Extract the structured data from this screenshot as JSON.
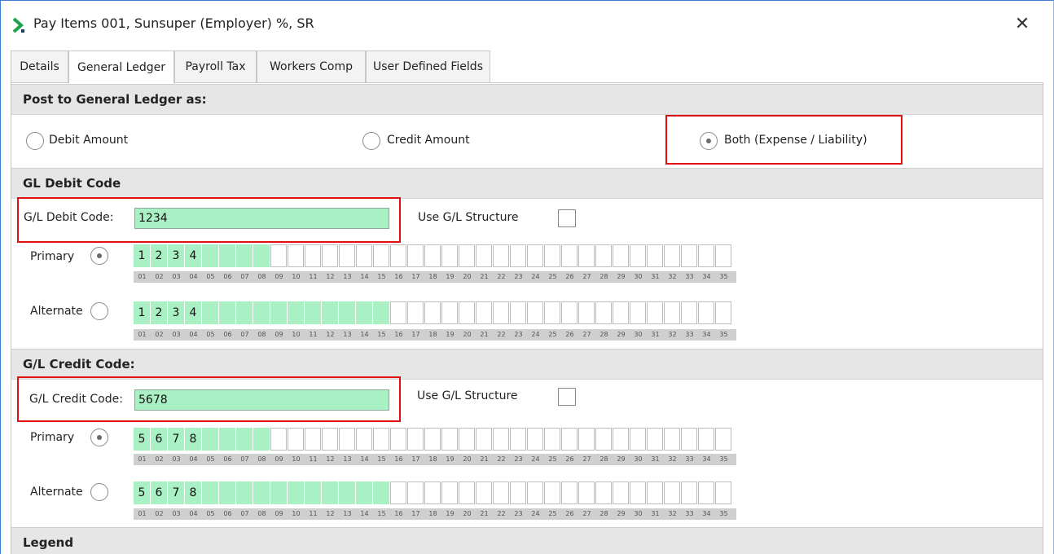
{
  "window": {
    "title": "Pay Items 001, Sunsuper (Employer) %, SR",
    "app_icon": "chevron-right-icon",
    "close_icon": "close-icon",
    "close_glyph": "✕"
  },
  "tabs": [
    {
      "label": "Details",
      "active": false
    },
    {
      "label": "General Ledger",
      "active": true
    },
    {
      "label": "Payroll Tax",
      "active": false
    },
    {
      "label": "Workers Comp",
      "active": false
    },
    {
      "label": "User Defined Fields",
      "active": false
    }
  ],
  "post_section": {
    "header": "Post to General Ledger as:",
    "options": [
      {
        "label": "Debit Amount",
        "selected": false
      },
      {
        "label": "Credit Amount",
        "selected": false
      },
      {
        "label": "Both (Expense / Liability)",
        "selected": true
      }
    ]
  },
  "debit_section": {
    "header": "GL Debit Code",
    "code_label": "G/L Debit Code:",
    "code_value": "1234",
    "use_structure_label": "Use G/L Structure",
    "use_structure_checked": false,
    "primary": {
      "label": "Primary",
      "selected": true,
      "chars": [
        "1",
        "2",
        "3",
        "4"
      ],
      "filled_count": 8
    },
    "alternate": {
      "label": "Alternate",
      "selected": false,
      "chars": [
        "1",
        "2",
        "3",
        "4"
      ],
      "filled_count": 15
    }
  },
  "credit_section": {
    "header": "G/L Credit Code:",
    "code_label": "G/L Credit Code:",
    "code_value": "5678",
    "use_structure_label": "Use G/L Structure",
    "use_structure_checked": false,
    "primary": {
      "label": "Primary",
      "selected": true,
      "chars": [
        "5",
        "6",
        "7",
        "8"
      ],
      "filled_count": 8
    },
    "alternate": {
      "label": "Alternate",
      "selected": false,
      "chars": [
        "5",
        "6",
        "7",
        "8"
      ],
      "filled_count": 15
    }
  },
  "segment_numbers": [
    "01",
    "02",
    "03",
    "04",
    "05",
    "06",
    "07",
    "08",
    "09",
    "10",
    "11",
    "12",
    "13",
    "14",
    "15",
    "16",
    "17",
    "18",
    "19",
    "20",
    "21",
    "22",
    "23",
    "24",
    "25",
    "26",
    "27",
    "28",
    "29",
    "30",
    "31",
    "32",
    "33",
    "34",
    "35"
  ],
  "legend_section": {
    "header": "Legend"
  },
  "colors": {
    "filled_segment": "#a9f0c4",
    "highlight_border": "#e01010",
    "section_header_bg": "#e6e6e6",
    "app_icon_green": "#1aa34a"
  }
}
